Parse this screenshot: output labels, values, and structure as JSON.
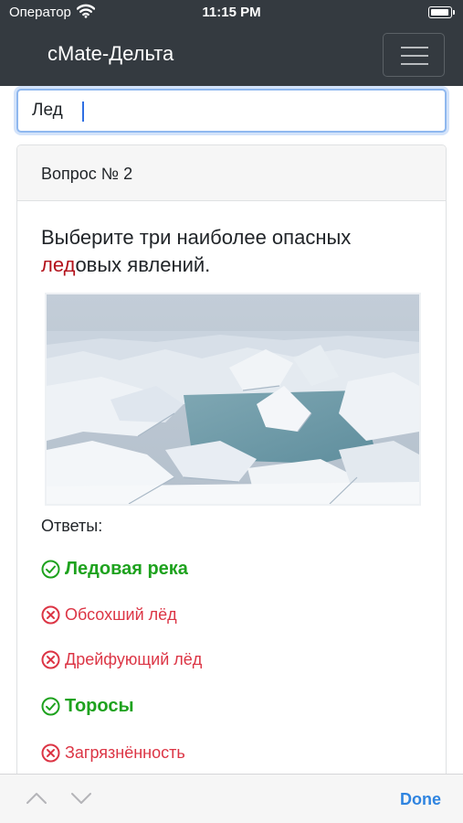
{
  "status": {
    "carrier": "Оператор",
    "time": "11:15 PM",
    "wifi_icon": "wifi-icon",
    "battery_icon": "battery-icon"
  },
  "nav": {
    "brand": "cMate-Дельта",
    "menu_icon": "hamburger-menu-icon"
  },
  "search": {
    "value": "Лед",
    "placeholder": ""
  },
  "card": {
    "header": "Вопрос № 2",
    "question_before": "Выберите три наиболее опасных ",
    "question_highlight": "лед",
    "question_after": "овых явлений.",
    "image_alt": "Торосы на льду",
    "answers_label": "Ответы:",
    "answers": [
      {
        "text": "Ледовая река",
        "correct": true,
        "icon": "check-circle-icon"
      },
      {
        "text": "Обсохший лёд",
        "correct": false,
        "icon": "x-circle-icon"
      },
      {
        "text": "Дрейфующий лёд",
        "correct": false,
        "icon": "x-circle-icon"
      },
      {
        "text": "Торосы",
        "correct": true,
        "icon": "check-circle-icon"
      },
      {
        "text": "Загрязнённость",
        "correct": false,
        "icon": "x-circle-icon"
      }
    ]
  },
  "keyboard_toolbar": {
    "done": "Done",
    "prev_icon": "chevron-up-icon",
    "next_icon": "chevron-down-icon"
  },
  "colors": {
    "navbar": "#343a40",
    "correct": "#1ea21e",
    "wrong": "#dc3545",
    "highlight": "#b3111b",
    "done": "#2f84e0"
  }
}
